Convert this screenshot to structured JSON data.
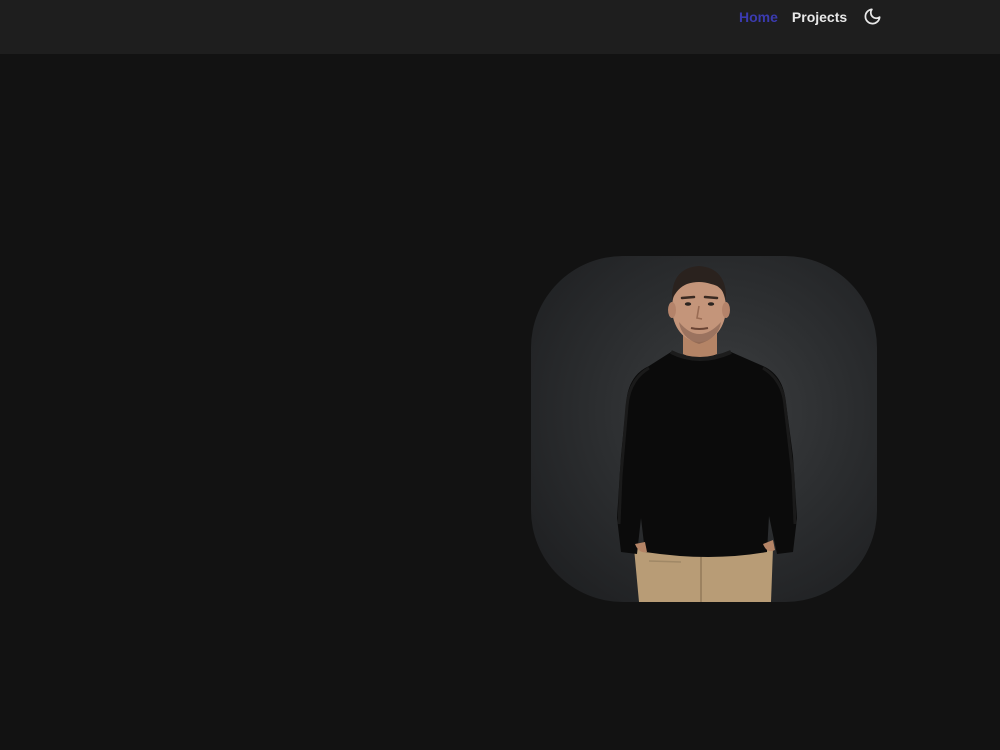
{
  "nav": {
    "home_label": "Home",
    "projects_label": "Projects",
    "theme_icon": "moon-icon"
  },
  "hero": {
    "portrait_icon": "portrait-photo"
  },
  "colors": {
    "background": "#121212",
    "navbar": "#1e1e1e",
    "accent": "#3b3bb0",
    "nav_text": "#e8e8e8"
  }
}
